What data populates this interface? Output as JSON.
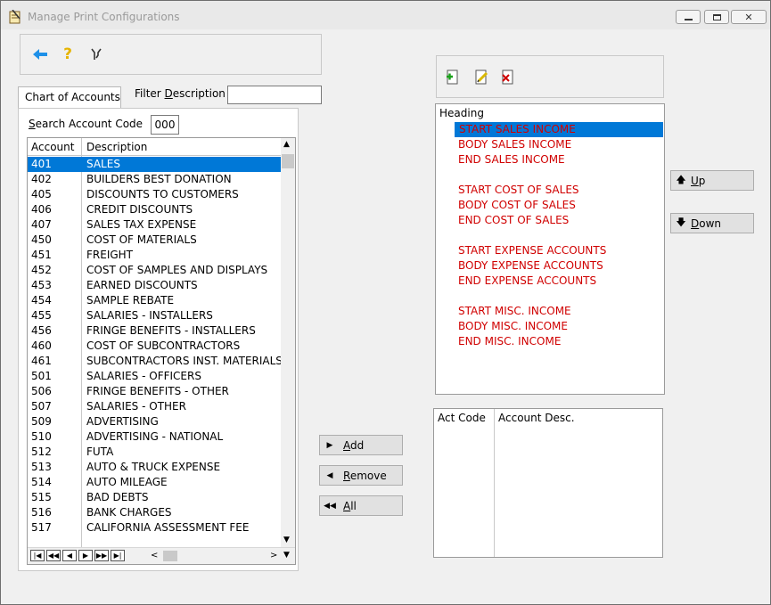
{
  "window": {
    "title": "Manage Print Configurations"
  },
  "toolbar": {
    "icons": [
      "back-arrow-icon",
      "help-icon",
      "tools-icon"
    ]
  },
  "tabs": {
    "chart_of_accounts": "Chart of Accounts"
  },
  "filter": {
    "label_pre": "Filter ",
    "label_u": "D",
    "label_post": "escription",
    "value": ""
  },
  "search": {
    "label_u": "S",
    "label_post": "earch Account Code",
    "value": "000"
  },
  "grid": {
    "headers": {
      "account": "Account",
      "description": "Description"
    },
    "rows": [
      {
        "account": "401",
        "description": "SALES"
      },
      {
        "account": "402",
        "description": "BUILDERS BEST DONATION"
      },
      {
        "account": "405",
        "description": "DISCOUNTS TO CUSTOMERS"
      },
      {
        "account": "406",
        "description": "CREDIT DISCOUNTS"
      },
      {
        "account": "407",
        "description": "SALES TAX EXPENSE"
      },
      {
        "account": "450",
        "description": "COST OF MATERIALS"
      },
      {
        "account": "451",
        "description": "FREIGHT"
      },
      {
        "account": "452",
        "description": "COST OF SAMPLES AND DISPLAYS"
      },
      {
        "account": "453",
        "description": "EARNED DISCOUNTS"
      },
      {
        "account": "454",
        "description": "SAMPLE REBATE"
      },
      {
        "account": "455",
        "description": "SALARIES - INSTALLERS"
      },
      {
        "account": "456",
        "description": "FRINGE BENEFITS - INSTALLERS"
      },
      {
        "account": "460",
        "description": "COST OF SUBCONTRACTORS"
      },
      {
        "account": "461",
        "description": "SUBCONTRACTORS INST. MATERIALS"
      },
      {
        "account": "501",
        "description": "SALARIES - OFFICERS"
      },
      {
        "account": "506",
        "description": "FRINGE BENEFITS - OTHER"
      },
      {
        "account": "507",
        "description": "SALARIES - OTHER"
      },
      {
        "account": "509",
        "description": "ADVERTISING"
      },
      {
        "account": "510",
        "description": "ADVERTISING - NATIONAL"
      },
      {
        "account": "512",
        "description": "FUTA"
      },
      {
        "account": "513",
        "description": "AUTO & TRUCK EXPENSE"
      },
      {
        "account": "514",
        "description": "AUTO MILEAGE"
      },
      {
        "account": "515",
        "description": "BAD DEBTS"
      },
      {
        "account": "516",
        "description": "BANK CHARGES"
      },
      {
        "account": "517",
        "description": "CALIFORNIA ASSESSMENT FEE"
      }
    ],
    "selected_index": 0
  },
  "buttons": {
    "add": {
      "u": "A",
      "rest": "dd"
    },
    "remove": {
      "u": "R",
      "rest": "emove"
    },
    "all": {
      "u": "A",
      "rest": "ll"
    },
    "up": {
      "u": "U",
      "rest": "p"
    },
    "down": {
      "u": "D",
      "rest": "own"
    }
  },
  "heading_list": {
    "title": "Heading",
    "items": [
      "START SALES INCOME",
      "BODY SALES INCOME",
      "END SALES INCOME",
      "",
      "START COST OF SALES",
      "BODY COST OF SALES",
      "END COST OF SALES",
      "",
      "START EXPENSE ACCOUNTS",
      "BODY EXPENSE ACCOUNTS",
      "END EXPENSE ACCOUNTS",
      "",
      "START MISC. INCOME",
      "BODY MISC. INCOME",
      "END MISC. INCOME"
    ],
    "selected_index": 0,
    "item_color": "#d00000"
  },
  "detail": {
    "headers": {
      "act_code": "Act Code",
      "account_desc": "Account Desc."
    }
  },
  "colors": {
    "selection": "#0078d7",
    "heading_text": "#d00000"
  }
}
